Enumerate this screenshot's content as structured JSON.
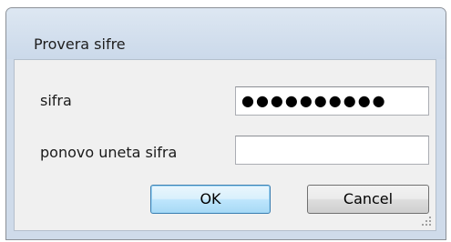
{
  "window": {
    "title": "Provera sifre"
  },
  "form": {
    "password_label": "sifra",
    "password_value": "●●●●●●●●●●",
    "confirm_label": "ponovo uneta sifra",
    "confirm_value": ""
  },
  "buttons": {
    "ok_label": "OK",
    "cancel_label": "Cancel"
  },
  "icons": {
    "resize_grip": "resize-grip-icon"
  },
  "colors": {
    "titlebar": "#cbd9ea",
    "dialog_body": "#f0f0f0",
    "default_button_border": "#3c7fb1"
  }
}
